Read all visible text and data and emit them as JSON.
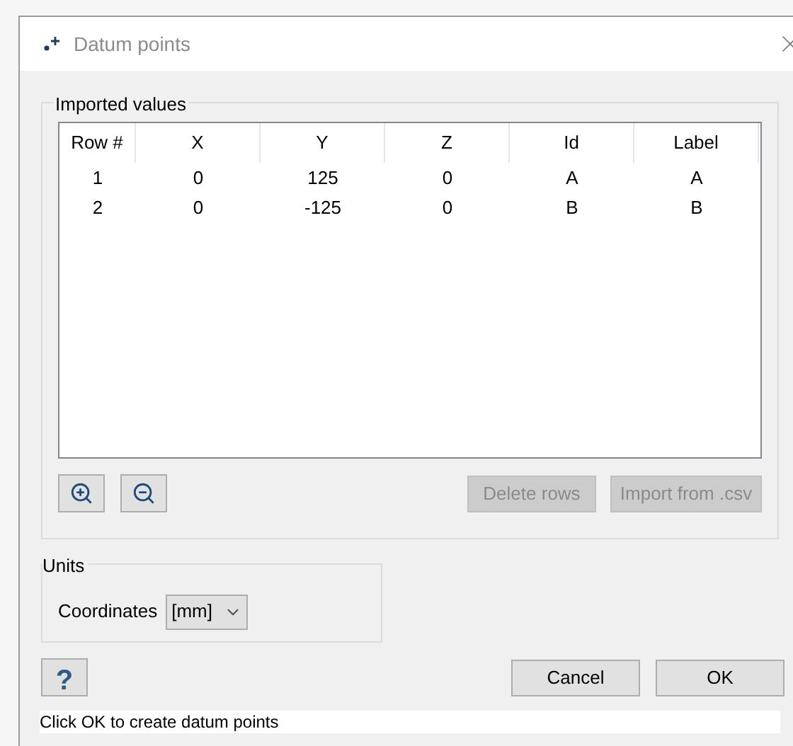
{
  "window": {
    "title": "Datum points"
  },
  "imported_values": {
    "title": "Imported values",
    "table": {
      "columns": [
        "Row #",
        "X",
        "Y",
        "Z",
        "Id",
        "Label"
      ],
      "rows": [
        [
          "1",
          "0",
          "125",
          "0",
          "A",
          "A"
        ],
        [
          "2",
          "0",
          "-125",
          "0",
          "B",
          "B"
        ]
      ]
    },
    "buttons": [
      {
        "label": "Delete rows",
        "disabled": true
      },
      {
        "label": "Import from .csv",
        "disabled": true
      }
    ]
  },
  "units": {
    "title": "Units",
    "label": "Coordinates",
    "value": "[mm]"
  },
  "help": {
    "label": "?"
  },
  "buttons": [
    {
      "label": "Cancel",
      "disabled": false
    },
    {
      "label": "OK",
      "disabled": false
    }
  ],
  "status_bar": "Click OK to create datum points"
}
